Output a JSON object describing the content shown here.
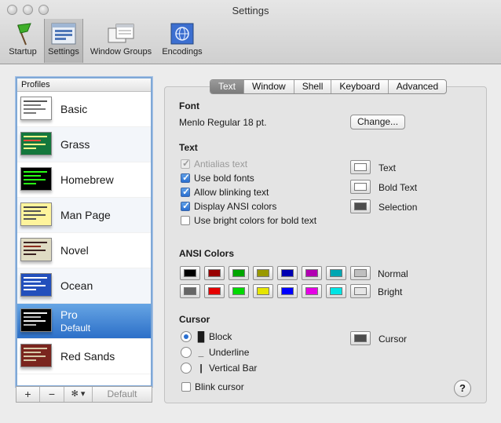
{
  "window": {
    "title": "Settings"
  },
  "toolbar": {
    "items": [
      {
        "label": "Startup",
        "icon": "startup-flag-icon"
      },
      {
        "label": "Settings",
        "icon": "terminal-settings-icon"
      },
      {
        "label": "Window Groups",
        "icon": "window-groups-icon"
      },
      {
        "label": "Encodings",
        "icon": "encodings-globe-icon"
      }
    ]
  },
  "profiles": {
    "header": "Profiles",
    "items": [
      {
        "name": "Basic"
      },
      {
        "name": "Grass"
      },
      {
        "name": "Homebrew"
      },
      {
        "name": "Man Page"
      },
      {
        "name": "Novel"
      },
      {
        "name": "Ocean"
      },
      {
        "name": "Pro",
        "sub": "Default"
      },
      {
        "name": "Red Sands"
      }
    ],
    "buttons": {
      "add": "+",
      "remove": "−",
      "gear": "✻ ▾",
      "default": "Default"
    }
  },
  "tabs": [
    "Text",
    "Window",
    "Shell",
    "Keyboard",
    "Advanced"
  ],
  "font": {
    "heading": "Font",
    "value": "Menlo Regular 18 pt.",
    "change_button": "Change..."
  },
  "text": {
    "heading": "Text",
    "options": [
      {
        "label": "Antialias text",
        "state": "disabled-checked"
      },
      {
        "label": "Use bold fonts",
        "state": "checked"
      },
      {
        "label": "Allow blinking text",
        "state": "checked"
      },
      {
        "label": "Display ANSI colors",
        "state": "checked"
      },
      {
        "label": "Use bright colors for bold text",
        "state": "unchecked"
      }
    ],
    "color_wells": [
      "Text",
      "Bold Text",
      "Selection"
    ]
  },
  "ansi": {
    "heading": "ANSI Colors",
    "normal_label": "Normal",
    "bright_label": "Bright",
    "normal": [
      "#000000",
      "#990000",
      "#00a600",
      "#999900",
      "#0000b2",
      "#b200b2",
      "#00a6b2",
      "#bfbfbf"
    ],
    "bright": [
      "#666666",
      "#e50000",
      "#00d900",
      "#e5e500",
      "#0000ff",
      "#e500e5",
      "#00e5e5",
      "#e5e5e5"
    ]
  },
  "cursor": {
    "heading": "Cursor",
    "options": [
      {
        "label": "Block",
        "glyph": "█",
        "selected": true
      },
      {
        "label": "Underline",
        "glyph": "_",
        "selected": false
      },
      {
        "label": "Vertical Bar",
        "glyph": "|",
        "selected": false
      }
    ],
    "blink_label": "Blink cursor",
    "color_label": "Cursor"
  },
  "help": "?",
  "colors": {
    "accent": "#3a7fd6",
    "text_well": "#ffffff",
    "bold_text_well": "#ffffff",
    "selection_well": "#4d4d4d",
    "cursor_well": "#4d4d4d"
  }
}
